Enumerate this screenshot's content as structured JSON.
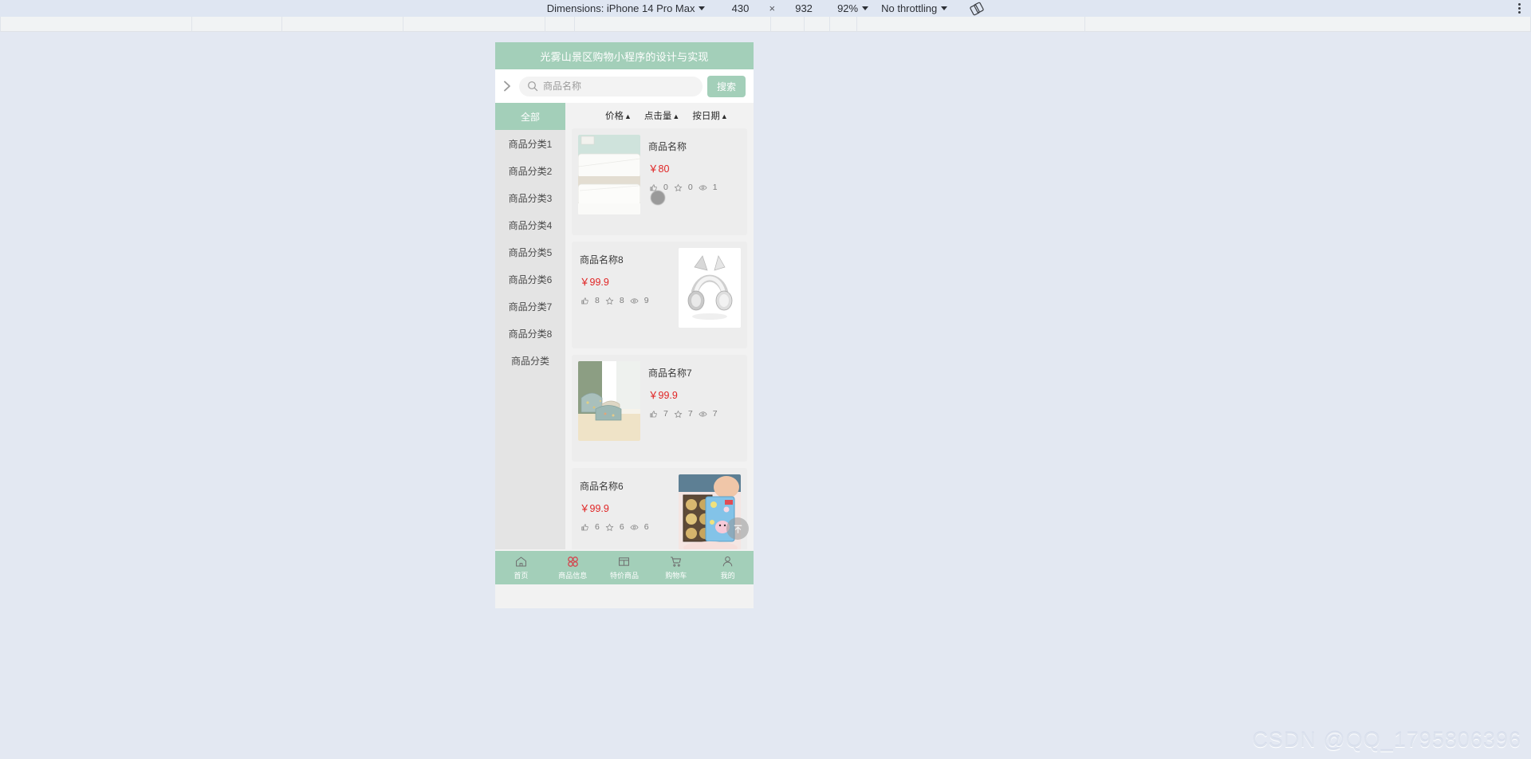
{
  "devtools": {
    "dimensions_label": "Dimensions: iPhone 14 Pro Max",
    "width": "430",
    "x_symbol": "×",
    "height": "932",
    "zoom": "92%",
    "throttling": "No throttling",
    "rotate_icon": "rotate-icon",
    "menu_icon": "kebab-menu-icon"
  },
  "app": {
    "title": "光雾山景区购物小程序的设计与实现",
    "header_bg": "#a3cfb9",
    "accent": "#a3cfb9",
    "price_color": "#e02424"
  },
  "search": {
    "back_icon": "chevron-right-icon",
    "magnifier_icon": "search-icon",
    "placeholder": "商品名称",
    "value": "",
    "button_label": "搜索"
  },
  "sidebar": {
    "items": [
      {
        "label": "全部",
        "active": true
      },
      {
        "label": "商品分类1",
        "active": false
      },
      {
        "label": "商品分类2",
        "active": false
      },
      {
        "label": "商品分类3",
        "active": false
      },
      {
        "label": "商品分类4",
        "active": false
      },
      {
        "label": "商品分类5",
        "active": false
      },
      {
        "label": "商品分类6",
        "active": false
      },
      {
        "label": "商品分类7",
        "active": false
      },
      {
        "label": "商品分类8",
        "active": false
      },
      {
        "label": "商品分类",
        "active": false
      }
    ]
  },
  "sortbar": {
    "items": [
      {
        "label": "价格",
        "arrow": "▲"
      },
      {
        "label": "点击量",
        "arrow": "▲"
      },
      {
        "label": "按日期",
        "arrow": "▲"
      }
    ]
  },
  "products": [
    {
      "name": "商品名称",
      "price": "￥80",
      "likes": "0",
      "favorites": "0",
      "views": "1",
      "image": "bedding",
      "image_side": "left"
    },
    {
      "name": "商品名称8",
      "price": "￥99.9",
      "likes": "8",
      "favorites": "8",
      "views": "9",
      "image": "headphones",
      "image_side": "right"
    },
    {
      "name": "商品名称7",
      "price": "￥99.9",
      "likes": "7",
      "favorites": "7",
      "views": "7",
      "image": "cushions",
      "image_side": "left"
    },
    {
      "name": "商品名称6",
      "price": "￥99.9",
      "likes": "6",
      "favorites": "6",
      "views": "6",
      "image": "chocolate",
      "image_side": "right"
    }
  ],
  "scroll_top": {
    "icon": "arrow-up-to-line-icon"
  },
  "tabbar": {
    "items": [
      {
        "label": "首页",
        "icon": "home-icon",
        "active": false
      },
      {
        "label": "商品信息",
        "icon": "grid-clover-icon",
        "active": true
      },
      {
        "label": "特价商品",
        "icon": "window-grid-icon",
        "active": false
      },
      {
        "label": "购物车",
        "icon": "shopping-cart-icon",
        "active": false
      },
      {
        "label": "我的",
        "icon": "person-icon",
        "active": false
      }
    ]
  },
  "watermark": {
    "text": "CSDN @QQ_1795806396"
  }
}
